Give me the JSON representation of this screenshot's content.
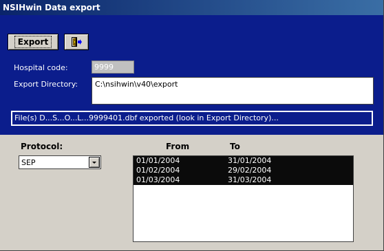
{
  "window": {
    "title": "NSIHwin Data export"
  },
  "toolbar": {
    "export_label": "Export"
  },
  "form": {
    "hospital_code_label": "Hospital code:",
    "hospital_code_value": "9999",
    "export_dir_label": "Export Directory:",
    "export_dir_value": "C:\\nsihwin\\v40\\export"
  },
  "status": {
    "text": "File(s) D...S...O...L...9999401.dbf exported (look in Export Directory)..."
  },
  "protocol": {
    "label": "Protocol:",
    "selected": "SEP"
  },
  "periods": {
    "from_header": "From",
    "to_header": "To",
    "rows": [
      {
        "from": "01/01/2004",
        "to": "31/01/2004"
      },
      {
        "from": "01/02/2004",
        "to": "29/02/2004"
      },
      {
        "from": "01/03/2004",
        "to": "31/03/2004"
      }
    ]
  },
  "colors": {
    "title_bar": "#0a246a",
    "panel": "#0b1d8c",
    "selection": "#0b0b0b",
    "face": "#d4d0c8"
  },
  "icons": {
    "exit": "exit-door-icon",
    "dropdown": "chevron-down-icon"
  }
}
